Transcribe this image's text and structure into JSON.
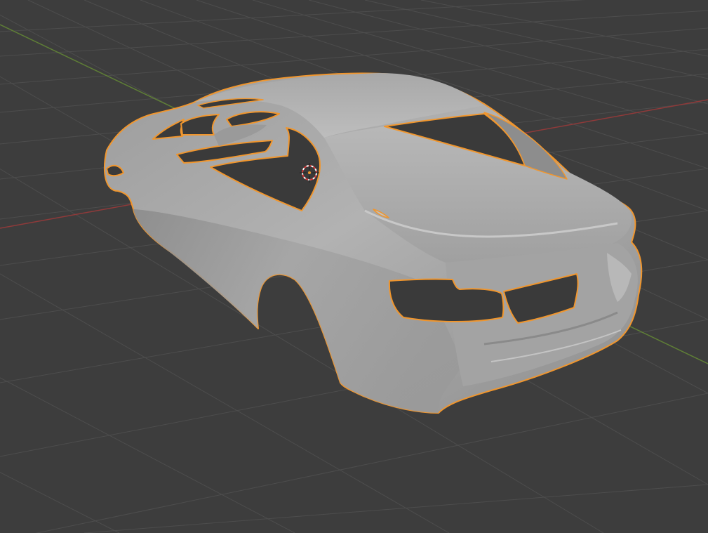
{
  "viewport": {
    "background_color": "#3d3d3d",
    "grid_color": "#555555",
    "x_axis_color": "#9a3b3b",
    "y_axis_color": "#6a8a3a",
    "selection_outline_color": "#f0962e",
    "mesh_shading_color": "#a9a9a9",
    "object": "car-body-mesh",
    "object_selected": true,
    "cursor": "3d-cursor-icon"
  }
}
